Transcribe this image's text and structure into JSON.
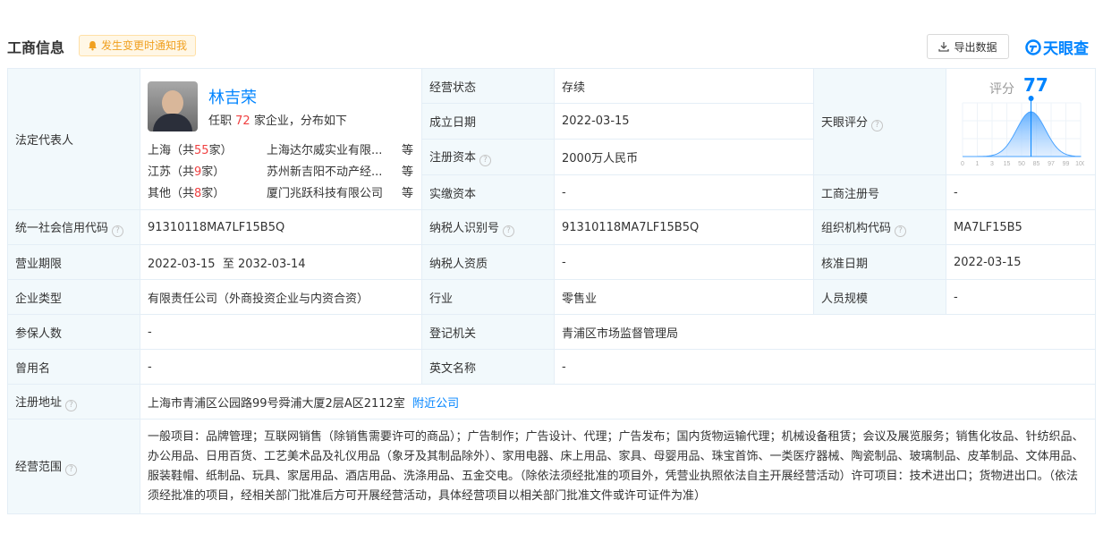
{
  "header": {
    "title": "工商信息",
    "notify_label": "发生变更时通知我",
    "export_label": "导出数据",
    "brand": "天眼查"
  },
  "legal": {
    "label": "法定代表人",
    "name": "林吉荣",
    "jobs_prefix": "任职",
    "jobs_count": "72",
    "jobs_suffix": "家企业，分布如下",
    "regions": [
      {
        "region": "上海（共",
        "count": "55",
        "unit": "家）",
        "company": "上海达尔威实业有限...",
        "suffix": "等"
      },
      {
        "region": "江苏（共",
        "count": "9",
        "unit": "家）",
        "company": "苏州新吉阳不动产经...",
        "suffix": "等"
      },
      {
        "region": "其他（共",
        "count": "8",
        "unit": "家）",
        "company": "厦门兆跃科技有限公司",
        "suffix": "等"
      }
    ]
  },
  "fields": {
    "status_label": "经营状态",
    "status": "存续",
    "found_label": "成立日期",
    "found": "2022-03-15",
    "capital_label": "注册资本",
    "capital": "2000万人民币",
    "paid_label": "实缴资本",
    "paid": "-",
    "score_label": "天眼评分",
    "regno_label": "工商注册号",
    "regno": "-",
    "credit_label": "统一社会信用代码",
    "credit": "91310118MA7LF15B5Q",
    "taxid_label": "纳税人识别号",
    "taxid": "91310118MA7LF15B5Q",
    "org_label": "组织机构代码",
    "org": "MA7LF15B5",
    "term_label": "营业期限",
    "term": "2022-03-15  至 2032-03-14",
    "taxq_label": "纳税人资质",
    "taxq": "-",
    "approve_label": "核准日期",
    "approve": "2022-03-15",
    "type_label": "企业类型",
    "type": "有限责任公司（外商投资企业与内资合资）",
    "industry_label": "行业",
    "industry": "零售业",
    "staff_label": "人员规模",
    "staff": "-",
    "insured_label": "参保人数",
    "insured": "-",
    "authority_label": "登记机关",
    "authority": "青浦区市场监督管理局",
    "former_label": "曾用名",
    "former": "-",
    "en_label": "英文名称",
    "en": "-",
    "addr_label": "注册地址",
    "addr": "上海市青浦区公园路99号舜浦大厦2层A区2112室",
    "nearby": "附近公司",
    "scope_label": "经营范围",
    "scope": "一般项目：品牌管理；互联网销售（除销售需要许可的商品）；广告制作；广告设计、代理；广告发布；国内货物运输代理；机械设备租赁；会议及展览服务；销售化妆品、针纺织品、办公用品、日用百货、工艺美术品及礼仪用品（象牙及其制品除外）、家用电器、床上用品、家具、母婴用品、珠宝首饰、一类医疗器械、陶瓷制品、玻璃制品、皮革制品、文体用品、服装鞋帽、纸制品、玩具、家居用品、酒店用品、洗涤用品、五金交电。（除依法须经批准的项目外，凭营业执照依法自主开展经营活动）许可项目：技术进出口；货物进出口。（依法须经批准的项目，经相关部门批准后方可开展经营活动，具体经营项目以相关部门批准文件或许可证件为准）"
  },
  "score": {
    "label": "评分",
    "value": "77",
    "ticks": [
      "0",
      "1",
      "3",
      "15",
      "50",
      "85",
      "97",
      "99",
      "100"
    ],
    "marker_position": 0.58
  },
  "colors": {
    "accent": "#0084ff",
    "label_bg": "#f2f9fc",
    "border": "#e4eef6",
    "highlight": "#f04142"
  }
}
